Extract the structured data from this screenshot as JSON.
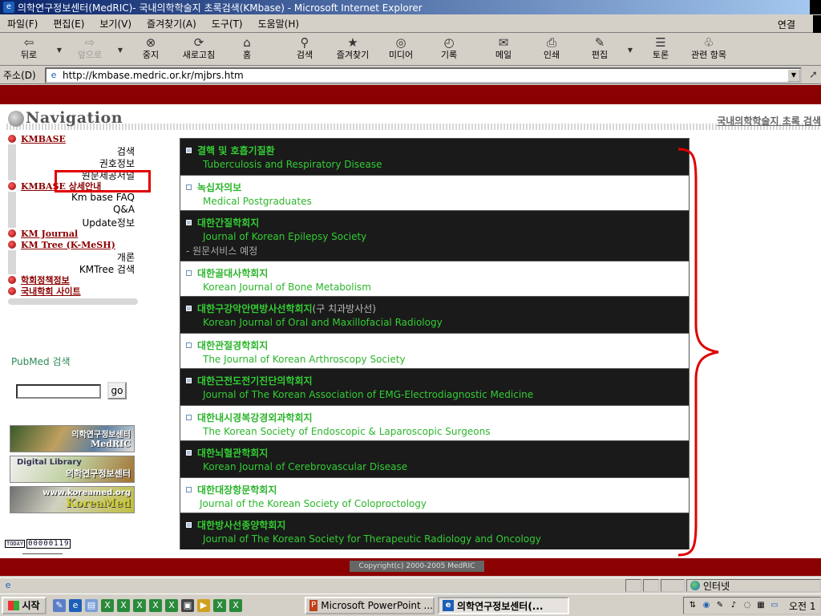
{
  "window": {
    "title": "의학연구정보센터(MedRIC)- 국내의학학술지 초록검색(KMbase) - Microsoft Internet Explorer"
  },
  "menubar": {
    "items": [
      "파일(F)",
      "편집(E)",
      "보기(V)",
      "즐겨찾기(A)",
      "도구(T)",
      "도움말(H)"
    ],
    "connect": "연결"
  },
  "toolbar": {
    "back": "뒤로",
    "forward": "앞으로",
    "stop": "중지",
    "refresh": "새로고침",
    "home": "홈",
    "search": "검색",
    "favorites": "즐겨찾기",
    "media": "미디어",
    "history": "기록",
    "mail": "메일",
    "print": "인쇄",
    "edit": "편집",
    "discuss": "토론",
    "related": "관련 항목"
  },
  "address": {
    "label": "주소(D)",
    "url": "http://kmbase.medric.or.kr/mjbrs.htm"
  },
  "page": {
    "nav_title": "Navigation",
    "top_right": "국내의학학술지 초록 검색",
    "sidebar": {
      "sections": [
        {
          "title": "KMBASE",
          "links": [
            "검색",
            "권호정보",
            "원문제공저널"
          ]
        },
        {
          "title": "KMBASE 상세안내",
          "links": [
            "Km base FAQ",
            "Q&A",
            "Update정보"
          ]
        },
        {
          "title": "KM Journal",
          "links": []
        },
        {
          "title": "KM Tree (K-MeSH)",
          "links": [
            "개론",
            "KMTree 검색"
          ]
        },
        {
          "title": "학회정책정보",
          "links": []
        },
        {
          "title": "국내학회 사이트",
          "links": []
        }
      ]
    },
    "pubmed": {
      "label": "PubMed 검색",
      "input_value": "",
      "go_label": "go"
    },
    "banners": {
      "b1_main": "의학연구정보센터",
      "b1_sub": "MedRIC",
      "b2_main": "Digital Library",
      "b2_sub": "의학연구정보센터",
      "b3_top": "www.koreamed.org",
      "b3_main": "KoreaMed"
    },
    "counter": {
      "label": "TODAY",
      "value": "00000119"
    },
    "journals": [
      {
        "ko": "결핵 및 호흡기질환",
        "en": "Tuberculosis and Respiratory Disease",
        "style": "dark"
      },
      {
        "ko": "녹십자의보",
        "en": "Medical Postgraduates",
        "style": "light"
      },
      {
        "ko": "대한간질학회지",
        "en": "Journal of Korean Epilepsy Society",
        "note": "- 원문서비스 예정",
        "style": "dark"
      },
      {
        "ko": "대한골대사학회지",
        "en": "Korean Journal of Bone Metabolism",
        "style": "light"
      },
      {
        "ko": "대한구강악안면방사선학회지",
        "sub": "(구 치과방사선)",
        "en": "Korean Journal of Oral and Maxillofacial Radiology",
        "style": "dark"
      },
      {
        "ko": "대한관절경학회지",
        "en": "The Journal of Korean Arthroscopy Society",
        "style": "light"
      },
      {
        "ko": "대한근전도전기진단의학회지",
        "en": "Journal of The Korean Association of EMG-Electrodiagnostic Medicine",
        "style": "dark"
      },
      {
        "ko": "대한내시경복강경외과학회지",
        "en": "The Korean Society of Endoscopic & Laparoscopic Surgeons",
        "style": "light"
      },
      {
        "ko": "대한뇌혈관학회지",
        "en": "Korean Journal of Cerebrovascular Disease",
        "style": "dark"
      },
      {
        "ko": "대한대장항문학회지",
        "en": "Journal of the Korean Society of Coloproctology",
        "style": "light"
      },
      {
        "ko": "대한방사선종양학회지",
        "en": "Journal of The Korean Society for Therapeutic Radiology and Oncology",
        "style": "dark"
      }
    ],
    "copyright": "Copyright(c) 2000-2005 MedRIC"
  },
  "statusbar": {
    "zone": "인터넷"
  },
  "taskbar": {
    "start": "시작",
    "tasks": [
      "Microsoft PowerPoint ...",
      "의학연구정보센터(..."
    ],
    "clock": "오전 1"
  },
  "colors": {
    "page_band": "#8b0000",
    "journal_text": "#33cc33",
    "highlight": "#e00000"
  }
}
